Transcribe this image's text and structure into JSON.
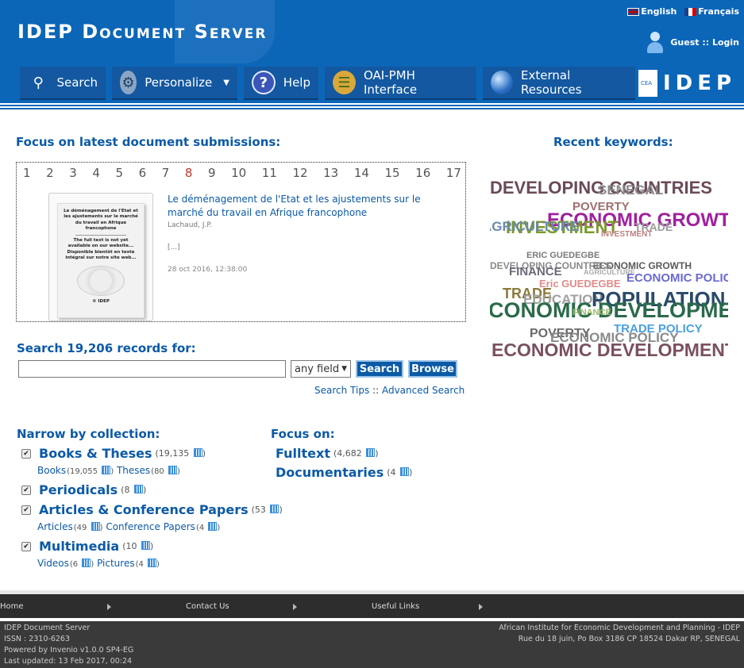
{
  "header": {
    "title_first": "IDEP",
    "title_rest": "Document Server",
    "languages": [
      "English",
      "Français"
    ],
    "user": "Guest :: Login",
    "logo_text": "IDEP",
    "logo_small": "CEA"
  },
  "nav": [
    {
      "label": "Search",
      "icon": "search-icon"
    },
    {
      "label": "Personalize",
      "icon": "gear-icon"
    },
    {
      "label": "Help",
      "icon": "help-icon"
    },
    {
      "label": "OAI-PMH Interface",
      "icon": "books-icon"
    },
    {
      "label": "External Resources",
      "icon": "globe-icon"
    }
  ],
  "focus": {
    "title": "Focus on latest document submissions:",
    "pages": [
      "1",
      "2",
      "3",
      "4",
      "5",
      "6",
      "7",
      "8",
      "9",
      "10",
      "11",
      "12",
      "13",
      "14",
      "15",
      "16",
      "17"
    ],
    "current_page": "8",
    "record": {
      "title": "Le déménagement de l'Etat et les ajustements sur le marché du travail en Afrique francophone",
      "author": "Lachaud, J.P.",
      "ellipsis": "[...]",
      "date": "28 oct 2016, 12:38:00",
      "thumb_title": "Le déménagement de l'Etat et les ajustements sur le marché du travail en Afrique francophone",
      "thumb_note": "The full text is not yet available on our website... Disponible bientôt en texte intégral sur notre site web...",
      "thumb_org": "© IDEP"
    }
  },
  "keywords": {
    "title": "Recent keywords:",
    "items": [
      {
        "text": "DEVELOPING COUNTRIES",
        "color": "#6b4a5a"
      },
      {
        "text": "SENEGAL",
        "color": "#8a8a8a"
      },
      {
        "text": "POVERTY",
        "color": "#a07070"
      },
      {
        "text": "ECONOMIC GROWTH",
        "color": "#a020a0"
      },
      {
        "text": "INVESTMENT",
        "color": "#7a9a2a"
      },
      {
        "text": "AGRICULTURE",
        "color": "#6a8aaa"
      },
      {
        "text": "TRADE",
        "color": "#9a9a9a"
      },
      {
        "text": "INVESTMENT",
        "color": "#c08080"
      },
      {
        "text": "ERIC GUEDEGBE",
        "color": "#7a7a7a"
      },
      {
        "text": "ECONOMIC GROWTH",
        "color": "#5a5a5a"
      },
      {
        "text": "DEVELOPING COUNTRIES",
        "color": "#8a8a8a"
      },
      {
        "text": "AGRICULTURE",
        "color": "#aaaaaa"
      },
      {
        "text": "FINANCE",
        "color": "#6a6a7a"
      },
      {
        "text": "ECONOMIC POLICY",
        "color": "#6a6ad0"
      },
      {
        "text": "Eric GUEDEGBE",
        "color": "#e08a8a"
      },
      {
        "text": "TRADE",
        "color": "#8a7a3a"
      },
      {
        "text": "EDUCATION",
        "color": "#a0a0a0"
      },
      {
        "text": "POPULATION",
        "color": "#2a4a6a"
      },
      {
        "text": "ECONOMIC DEVELOPMENT",
        "color": "#2a6a4a"
      },
      {
        "text": "FINANCE",
        "color": "#9aba6a"
      },
      {
        "text": "TRADE POLICY",
        "color": "#4aa0e0"
      },
      {
        "text": "POVERTY",
        "color": "#6a6a6a"
      },
      {
        "text": "ECONOMIC POLICY",
        "color": "#8a8a8a"
      },
      {
        "text": "ECONOMIC DEVELOPMENT",
        "color": "#7a5060"
      }
    ]
  },
  "search": {
    "title": "Search 19,206 records for:",
    "input_value": "",
    "field": "any field",
    "search_label": "Search",
    "browse_label": "Browse",
    "tips": "Search Tips",
    "sep": "::",
    "advanced": "Advanced Search"
  },
  "narrow": {
    "title": "Narrow by collection:",
    "collections": [
      {
        "name": "Books & Theses",
        "count": "(19,135",
        "subs": [
          {
            "name": "Books",
            "count": "(19,055"
          },
          {
            "name": "Theses",
            "count": "(80"
          }
        ]
      },
      {
        "name": "Periodicals",
        "count": "(8",
        "subs": []
      },
      {
        "name": "Articles & Conference Papers",
        "count": "(53",
        "subs": [
          {
            "name": "Articles",
            "count": "(49"
          },
          {
            "name": "Conference Papers",
            "count": "(4"
          }
        ]
      },
      {
        "name": "Multimedia",
        "count": "(10",
        "subs": [
          {
            "name": "Videos",
            "count": "(6"
          },
          {
            "name": "Pictures",
            "count": "(4"
          }
        ]
      }
    ]
  },
  "focus_on": {
    "title": "Focus on:",
    "items": [
      {
        "name": "Fulltext",
        "count": "(4,682"
      },
      {
        "name": "Documentaries",
        "count": "(4"
      }
    ]
  },
  "footer": {
    "nav": [
      "Home",
      "Contact Us",
      "Useful Links"
    ],
    "left": [
      "IDEP Document Server",
      "ISSN : 2310-6263",
      "Powered by Invenio v1.0.0 SP4-EG",
      "Last updated: 13 Feb 2017, 00:24"
    ],
    "right": [
      "African Institute for Economic Development and Planning - IDEP",
      "Rue du 18 juin, Po Box 3186 CP 18524 Dakar RP, SENEGAL"
    ]
  }
}
